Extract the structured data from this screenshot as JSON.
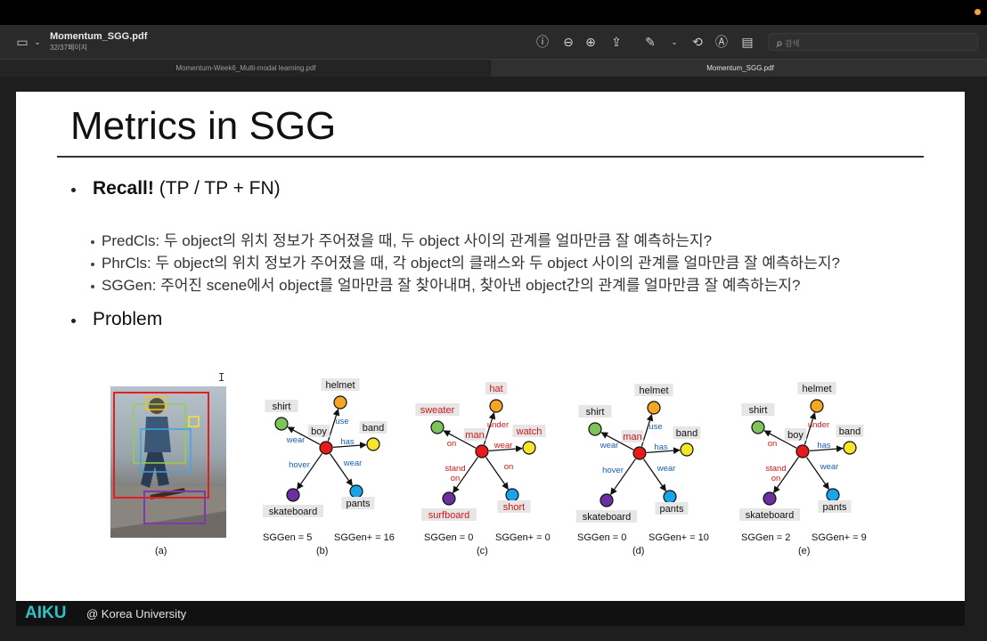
{
  "window": {
    "doc_title": "Momentum_SGG.pdf",
    "doc_pages": "32/37페이지",
    "search_placeholder": "검색",
    "tabs": [
      {
        "label": "Momentum-Week6_Multi-modal learning.pdf",
        "active": false
      },
      {
        "label": "Momentum_SGG.pdf",
        "active": true
      }
    ]
  },
  "slide": {
    "title": "Metrics in SGG",
    "recall_bold": "Recall!",
    "recall_rest": " (TP / TP + FN)",
    "sub_bullets": [
      "PredCls: 두 object의 위치 정보가 주어졌을 때, 두 object 사이의 관계를 얼마만큼 잘 예측하는지?",
      "PhrCls: 두 object의 위치 정보가 주어졌을 때, 각 object의 클래스와 두 object 사이의 관계를 얼마만큼 잘 예측하는지?",
      "SGGen: 주어진 scene에서 object를 얼마만큼 잘 찾아내며, 찾아낸 object간의 관계를 얼마만큼 잘 예측하는지?"
    ],
    "problem": "Problem",
    "figure": {
      "captions": [
        "(a)",
        "(b)",
        "(c)",
        "(d)",
        "(e)"
      ],
      "graphs": [
        {
          "nodes": {
            "center": "boy",
            "top": "helmet",
            "left": "shirt",
            "right": "band",
            "bottom_left": "skateboard",
            "bottom_right": "pants"
          },
          "edges": {
            "top": "use",
            "left": "wear",
            "right": "has",
            "bottom_left": "hover",
            "bottom_right": "wear"
          },
          "sggen": "SGGen = 5",
          "sggen_plus": "SGGen+ = 16",
          "red": []
        },
        {
          "nodes": {
            "center": "man",
            "top": "hat",
            "left": "sweater",
            "right": "watch",
            "bottom_left": "surfboard",
            "bottom_right": "short"
          },
          "edges": {
            "top": "under",
            "left": "on",
            "right": "wear",
            "bottom_left": "stand on",
            "bottom_right": "on"
          },
          "sggen": "SGGen = 0",
          "sggen_plus": "SGGen+ = 0",
          "red": [
            "center",
            "top",
            "left",
            "right",
            "bottom_left",
            "bottom_right",
            "e_top",
            "e_left",
            "e_right",
            "e_bottom_left",
            "e_bottom_right"
          ]
        },
        {
          "nodes": {
            "center": "man",
            "top": "helmet",
            "left": "shirt",
            "right": "band",
            "bottom_left": "skateboard",
            "bottom_right": "pants"
          },
          "edges": {
            "top": "use",
            "left": "wear",
            "right": "has",
            "bottom_left": "hover",
            "bottom_right": "wear"
          },
          "sggen": "SGGen = 0",
          "sggen_plus": "SGGen+ = 10",
          "red": [
            "center"
          ]
        },
        {
          "nodes": {
            "center": "boy",
            "top": "helmet",
            "left": "shirt",
            "right": "band",
            "bottom_left": "skateboard",
            "bottom_right": "pants"
          },
          "edges": {
            "top": "under",
            "left": "on",
            "right": "has",
            "bottom_left": "stand on",
            "bottom_right": "wear"
          },
          "sggen": "SGGen = 2",
          "sggen_plus": "SGGen+ = 9",
          "red": [
            "e_top",
            "e_left",
            "e_bottom_left"
          ]
        }
      ]
    }
  },
  "footer": {
    "logo": "AIKU",
    "org": "@ Korea University"
  },
  "colors": {
    "node_top": "#f5a623",
    "node_left": "#7dc45a",
    "node_right": "#f5e62a",
    "node_center": "#e81b1b",
    "node_bottom_left": "#6b2fa0",
    "node_bottom_right": "#1aa3e8",
    "edge_blue": "#1a5fb4",
    "edge_red": "#d01818",
    "accent_logo": "#2fc1c9"
  }
}
